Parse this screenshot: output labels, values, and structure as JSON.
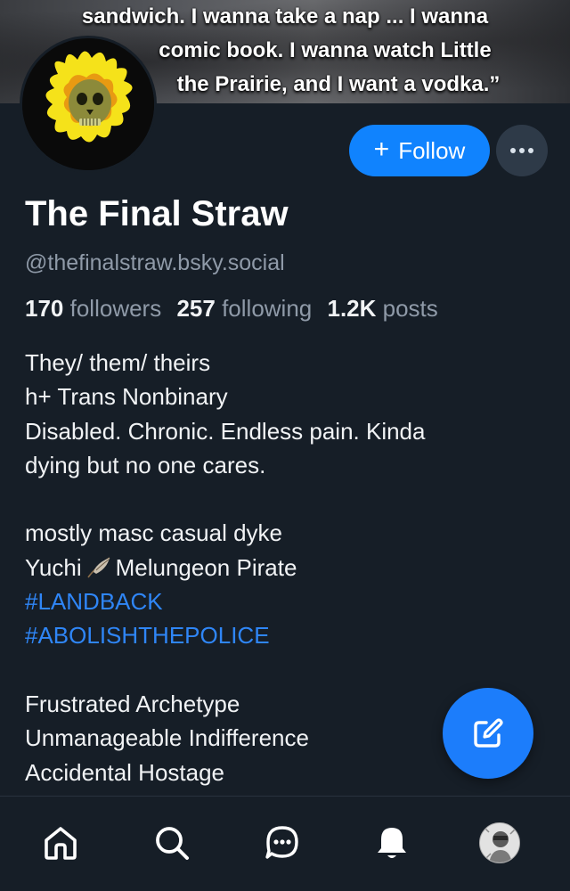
{
  "banner": {
    "lines": [
      "sandwich.  I wanna take a nap ... I wanna",
      "comic book.  I wanna watch Little",
      "the Prairie, and I want a vodka.”"
    ]
  },
  "profile": {
    "display_name": "The Final Straw",
    "handle": "@thefinalstraw.bsky.social",
    "followers_count": "170",
    "followers_label": "followers",
    "following_count": "257",
    "following_label": "following",
    "posts_count": "1.2K",
    "posts_label": "posts"
  },
  "actions": {
    "follow_plus": "+",
    "follow_label": "Follow",
    "more_icon": "ellipsis-icon"
  },
  "bio": {
    "line1": "They/ them/ theirs",
    "line2": "h+ Trans Nonbinary",
    "line3": "Disabled. Chronic. Endless pain. Kinda",
    "line4": "dying but no one cares.",
    "line5": "mostly masc casual dyke",
    "line6a": "Yuchi",
    "line6b": "Melungeon Pirate",
    "tag1": "#LANDBACK",
    "tag2": "#ABOLISHTHEPOLICE",
    "line7": "Frustrated Archetype",
    "line8": "Unmanageable Indifference",
    "line9": "Accidental Hostage"
  },
  "fab": {
    "icon": "compose-icon"
  },
  "tabbar": {
    "items": [
      "home-icon",
      "search-icon",
      "chat-icon",
      "bell-icon",
      "profile-avatar"
    ]
  },
  "colors": {
    "background": "#161e27",
    "accent": "#1083fe",
    "link": "#2f86f7",
    "muted_text": "#8f9aa8"
  }
}
